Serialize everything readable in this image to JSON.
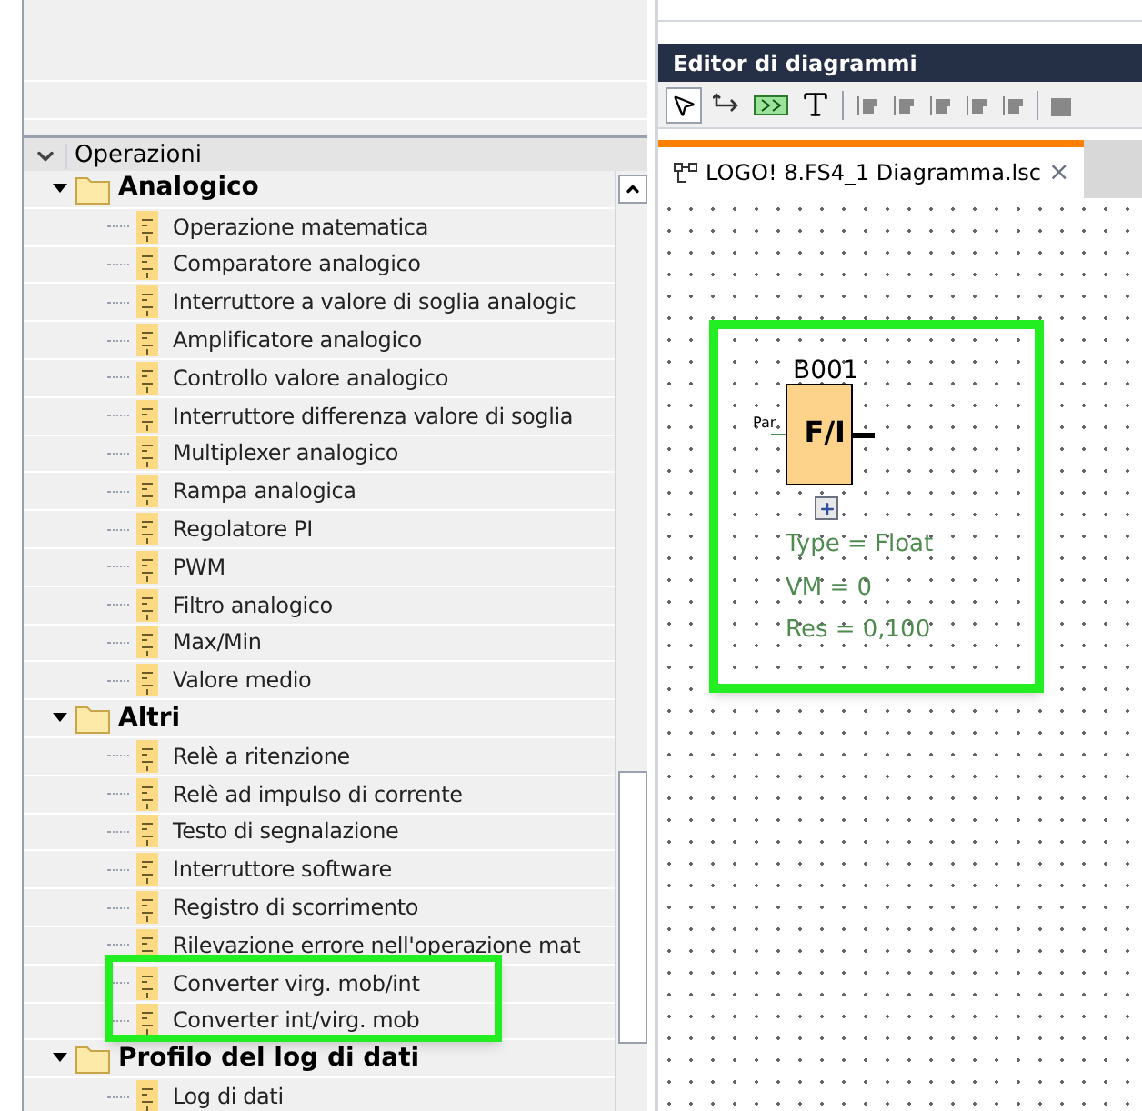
{
  "operations_panel": {
    "title": "Operazioni",
    "expanded": true
  },
  "tree": [
    {
      "kind": "continuation",
      "children": [
        {
          "kind": "folder",
          "label": "Analogico",
          "expanded": true,
          "children": [
            {
              "kind": "block",
              "label": "Operazione matematica"
            },
            {
              "kind": "block",
              "label": "Comparatore analogico"
            },
            {
              "kind": "block",
              "label": "Interruttore a valore di soglia analogic"
            },
            {
              "kind": "block",
              "label": "Amplificatore analogico"
            },
            {
              "kind": "block",
              "label": "Controllo valore analogico"
            },
            {
              "kind": "block",
              "label": "Interruttore differenza valore di soglia"
            },
            {
              "kind": "block",
              "label": "Multiplexer analogico"
            },
            {
              "kind": "block",
              "label": "Rampa analogica"
            },
            {
              "kind": "block",
              "label": "Regolatore PI"
            },
            {
              "kind": "block",
              "label": "PWM"
            },
            {
              "kind": "block",
              "label": "Filtro analogico"
            },
            {
              "kind": "block",
              "label": "Max/Min"
            },
            {
              "kind": "block",
              "label": "Valore medio"
            }
          ]
        },
        {
          "kind": "folder",
          "label": "Altri",
          "expanded": true,
          "children": [
            {
              "kind": "block",
              "label": "Relè a ritenzione"
            },
            {
              "kind": "block",
              "label": "Relè ad impulso di corrente"
            },
            {
              "kind": "block",
              "label": "Testo di segnalazione"
            },
            {
              "kind": "block",
              "label": "Interruttore software"
            },
            {
              "kind": "block",
              "label": "Registro di scorrimento"
            },
            {
              "kind": "block",
              "label": "Rilevazione errore nell'operazione mat"
            },
            {
              "kind": "block",
              "label": "Converter virg. mob/int"
            },
            {
              "kind": "block",
              "label": "Converter int/virg. mob"
            }
          ]
        }
      ]
    },
    {
      "kind": "folder",
      "label": "Profilo del log di dati",
      "expanded": true,
      "children": [
        {
          "kind": "block",
          "label": "Log di dati"
        }
      ]
    }
  ],
  "editor": {
    "title": "Editor di diagrammi",
    "tab": {
      "label": "LOGO! 8.FS4_1 Diagramma.lsc",
      "close": "×",
      "selected": true
    },
    "block": {
      "id": "B001",
      "symbol": "F/I",
      "input": "Par",
      "params": [
        "Type = Float",
        "VM = 0",
        "Res = 0,100"
      ]
    }
  }
}
